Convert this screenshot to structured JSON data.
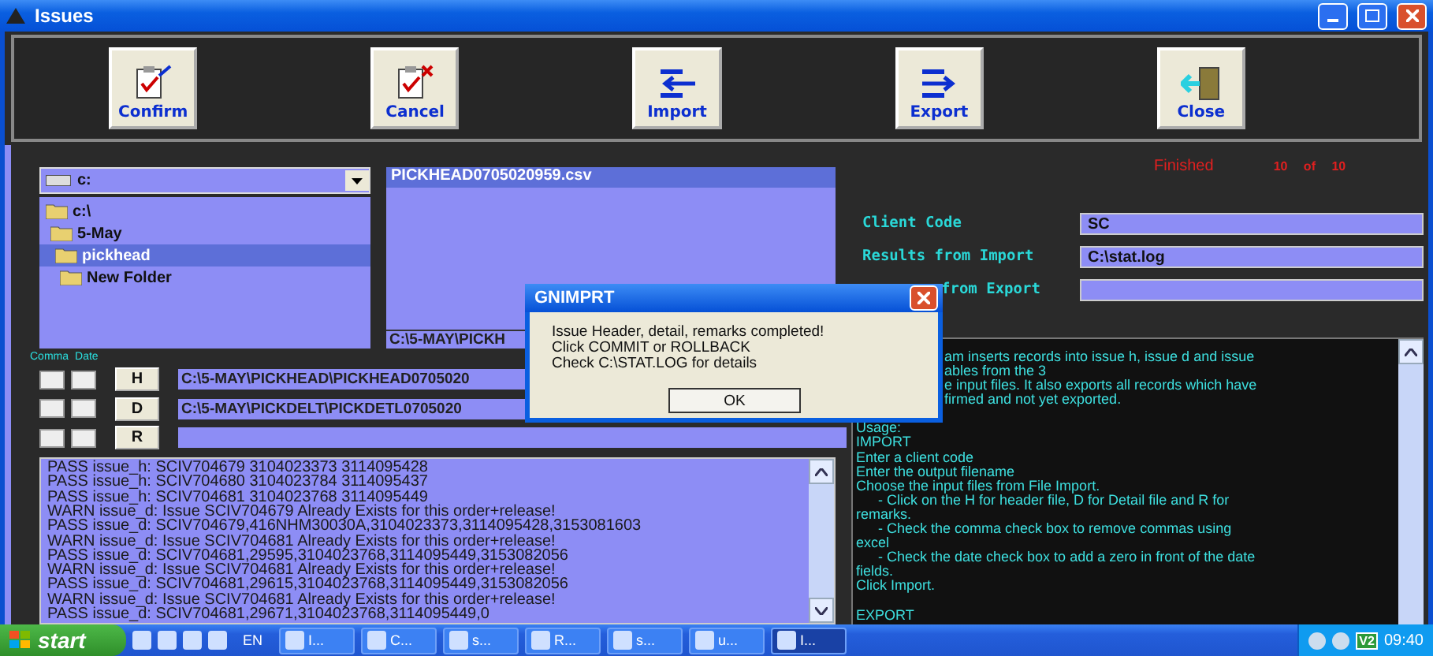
{
  "window": {
    "title": "Issues"
  },
  "toolbar": [
    {
      "label": "Confirm",
      "kind": "confirm"
    },
    {
      "label": "Cancel",
      "kind": "cancel"
    },
    {
      "label": "Import",
      "kind": "import"
    },
    {
      "label": "Export",
      "kind": "export"
    },
    {
      "label": "Close",
      "kind": "close"
    }
  ],
  "drive": {
    "value": "c:"
  },
  "folders": [
    {
      "label": "c:\\",
      "selected": false,
      "children": [
        {
          "label": "5-May",
          "selected": false,
          "children": [
            {
              "label": "pickhead",
              "selected": true,
              "children": [
                {
                  "label": "New Folder",
                  "selected": false
                }
              ]
            }
          ]
        }
      ]
    }
  ],
  "files": {
    "items": [
      {
        "label": "PICKHEAD0705020959.csv",
        "selected": true
      }
    ],
    "path": "C:\\5-MAY\\PICKH"
  },
  "option_headers": {
    "comma": "Comma",
    "date": "Date"
  },
  "inputs": [
    {
      "button": "H",
      "comma": false,
      "date": false,
      "path": "C:\\5-MAY\\PICKHEAD\\PICKHEAD0705020"
    },
    {
      "button": "D",
      "comma": false,
      "date": false,
      "path": "C:\\5-MAY\\PICKDELT\\PICKDETL0705020"
    },
    {
      "button": "R",
      "comma": false,
      "date": false
    }
  ],
  "log": [
    "PASS issue_h: SCIV704679 3104023373 3114095428",
    "PASS issue_h: SCIV704680 3104023784 3114095437",
    "PASS issue_h: SCIV704681 3104023768 3114095449",
    "WARN issue_d: Issue SCIV704679 Already Exists for this order+release!",
    "PASS issue_d: SCIV704679,416NHM30030A,3104023373,3114095428,3153081603",
    "WARN issue_d: Issue SCIV704681 Already Exists for this order+release!",
    "PASS issue_d: SCIV704681,29595,3104023768,3114095449,3153082056",
    "WARN issue_d: Issue SCIV704681 Already Exists for this order+release!",
    "PASS issue_d: SCIV704681,29615,3104023768,3114095449,3153082056",
    "WARN issue_d: Issue SCIV704681 Already Exists for this order+release!",
    "PASS issue_d: SCIV704681,29671,3104023768,3114095449,0"
  ],
  "status": {
    "text": "Finished",
    "count": "10 of 10"
  },
  "fields": [
    {
      "label": "Client Code",
      "value": "SC",
      "kind": "full"
    },
    {
      "label": "Results from Import",
      "value": "C:\\stat.log",
      "kind": "full"
    },
    {
      "label": "from Export",
      "kind": "partial"
    }
  ],
  "description": [
    {
      "text": "am inserts records into issue h, issue d and issue",
      "kind": "partial"
    },
    {
      "text": "ables from the 3",
      "kind": "partial"
    },
    {
      "text": "e input files. It also exports all records which have",
      "kind": "partial"
    },
    {
      "text": "firmed and not yet exported.",
      "kind": "partial"
    },
    {
      "text": "Usage:",
      "kind": "gap"
    },
    {
      "text": "IMPORT",
      "kind": "text"
    },
    {
      "text": "Enter a client code",
      "kind": "text"
    },
    {
      "text": "Enter the output filename",
      "kind": "text"
    },
    {
      "text": "Choose the input files from File Import.",
      "kind": "text"
    },
    {
      "text": "- Click on the H for header file, D for Detail file and R for",
      "kind": "sub"
    },
    {
      "text": "remarks.",
      "kind": "text"
    },
    {
      "text": "- Check the comma check box to remove commas using",
      "kind": "sub"
    },
    {
      "text": "excel",
      "kind": "text"
    },
    {
      "text": "- Check the date check box to add a zero in front of the date",
      "kind": "sub"
    },
    {
      "text": "fields.",
      "kind": "text"
    },
    {
      "text": "Click Import.",
      "kind": "text"
    },
    {
      "text": "EXPORT",
      "kind": "gap"
    }
  ],
  "dialog": {
    "title": "GNIMPRT",
    "lines": [
      "Issue Header, detail, remarks completed!",
      "Click COMMIT or ROLLBACK",
      "Check C:\\STAT.LOG for details"
    ],
    "button": "OK"
  },
  "taskbar": {
    "start": "start",
    "language": "EN",
    "tasks": [
      {
        "label": "I...",
        "selected": false
      },
      {
        "label": "C...",
        "selected": false
      },
      {
        "label": "s...",
        "selected": false
      },
      {
        "label": "R...",
        "selected": false
      },
      {
        "label": "s...",
        "selected": false
      },
      {
        "label": "u...",
        "selected": false
      },
      {
        "label": "I...",
        "selected": true
      }
    ],
    "tray_badge": "V2",
    "clock": "09:40"
  }
}
